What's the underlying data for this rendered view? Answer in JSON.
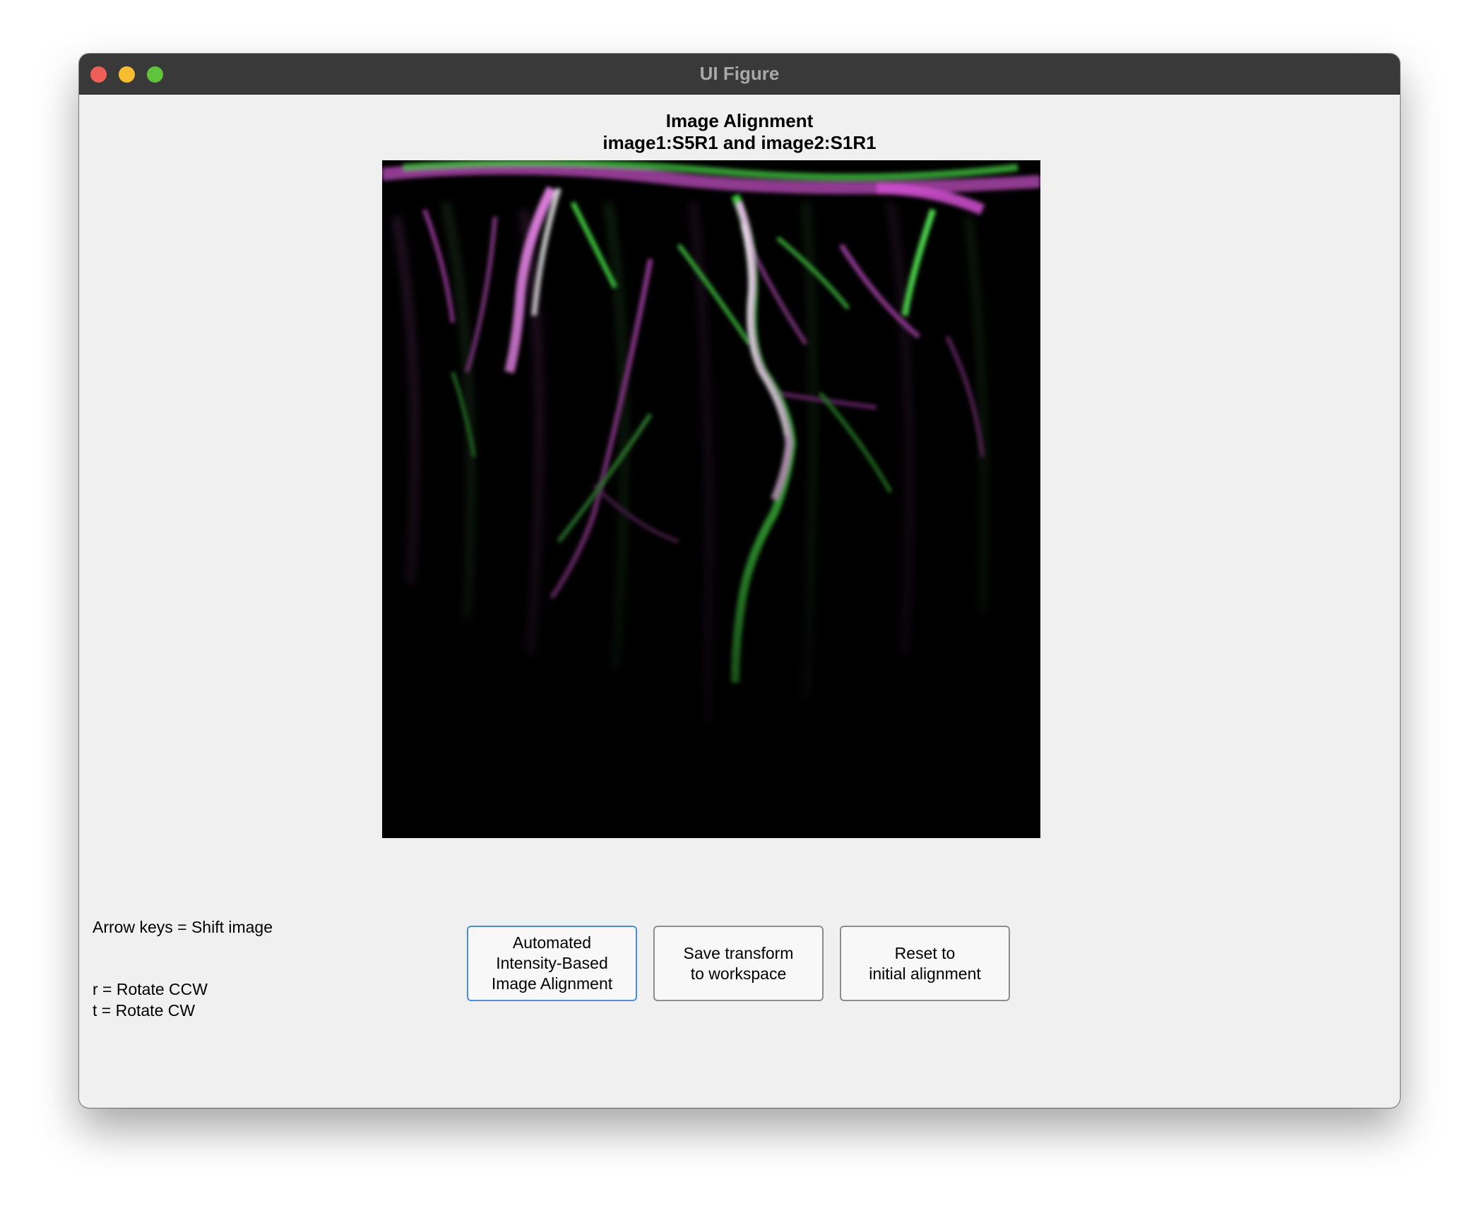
{
  "window": {
    "title": "UI Figure"
  },
  "plot": {
    "title_line1": "Image Alignment",
    "title_line2": "image1:S5R1 and image2:S1R1",
    "colors": {
      "image1": "#e040e0",
      "image2": "#30e030",
      "overlap": "#ffffff",
      "background": "#000000"
    }
  },
  "help": {
    "shift": "Arrow keys = Shift image",
    "rotate_ccw": "r = Rotate CCW",
    "rotate_cw": "t = Rotate CW"
  },
  "buttons": {
    "auto_align": "Automated\nIntensity-Based\nImage Alignment",
    "save_transform": "Save transform\nto workspace",
    "reset": "Reset to\ninitial alignment"
  }
}
